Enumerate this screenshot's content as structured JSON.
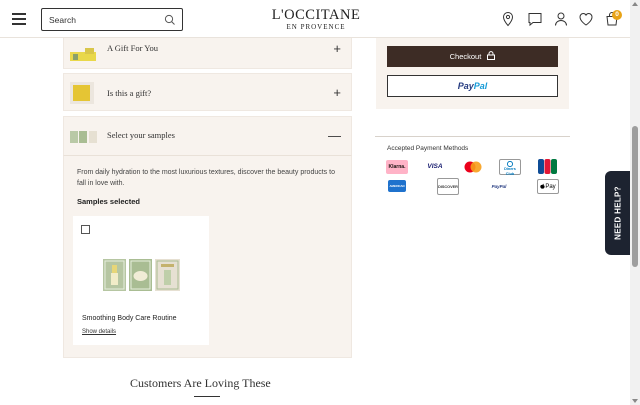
{
  "header": {
    "search_placeholder": "Search",
    "brand": "L'OCCITANE",
    "brand_sub": "EN PROVENCE",
    "cart_count": "0",
    "icons": [
      "menu-icon",
      "search-icon",
      "store-locator-icon",
      "chat-icon",
      "account-icon",
      "wishlist-icon",
      "cart-icon"
    ]
  },
  "accordion": {
    "gift_title": "A Gift For You",
    "gift_sign": "+",
    "is_gift_title": "Is this a gift?",
    "is_gift_sign": "+",
    "samples_title": "Select your samples",
    "samples_sign": "—"
  },
  "samples": {
    "description": "From daily hydration to the most luxurious textures, discover the beauty products to fall in love with.",
    "selected_label": "Samples selected",
    "product_name": "Smoothing Body Care Routine",
    "show_details": "Show details"
  },
  "right": {
    "checkout_label": "Checkout",
    "paypal_part1": "Pay",
    "paypal_part2": "Pal",
    "payment_methods_title": "Accepted Payment Methods",
    "payment_labels": {
      "klarna": "Klarna.",
      "visa": "VISA",
      "dinersclub": "Diners Club",
      "jcb": "JCB",
      "amex": "AMERICAN EXPRESS",
      "discover": "DISCOVER",
      "paypal": "PayPal",
      "applepay": "Pay"
    }
  },
  "footer": {
    "section_title": "Customers Are Loving These"
  },
  "help": {
    "label": "NEED HELP?"
  },
  "colors": {
    "accent": "#3d2c25",
    "panel_bg": "#f8f3ee",
    "badge": "#e8a317",
    "help_bg": "#1d2330"
  }
}
